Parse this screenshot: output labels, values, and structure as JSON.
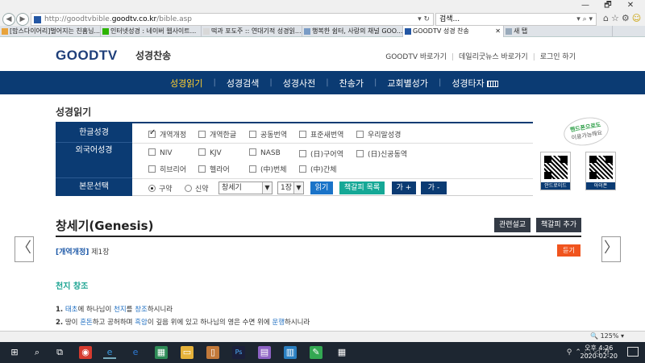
{
  "window": {
    "minimize": "🗗",
    "close": "✕"
  },
  "browser": {
    "url_prefix": "http://goodtvbible.",
    "url_domain": "goodtv.co.kr",
    "url_path": "/bible.asp",
    "url_tools": "▾ ↻",
    "search_value": "검색...",
    "search_tools": "▾ ⌕ ▾",
    "tabs": [
      {
        "label": "[맘스다이어리]벌어지는 친홈님...",
        "color": "#e8a33c"
      },
      {
        "label": "인터넷성경 : 네이버 웹사이트...",
        "color": "#2db400"
      },
      {
        "label": "떡과 포도주 :: 연대기적 성경읽...",
        "color": "#d8d8d8"
      },
      {
        "label": "행복한 쉼터, 사랑의 채널 GOO...",
        "color": "#7a9cc6"
      },
      {
        "label": "GOODTV 성경 찬송",
        "color": "#2457a4"
      },
      {
        "label": "새 탭",
        "color": "#9ab"
      }
    ]
  },
  "site": {
    "logo_good": "GOOD",
    "logo_tv": "TV",
    "logo_sub": "성경찬송",
    "top_links": [
      "GOODTV 바로가기",
      "데일리굿뉴스 바로가기",
      "로그인 하기"
    ],
    "menu": [
      "성경읽기",
      "성경검색",
      "성경사전",
      "찬송가",
      "교회별성가",
      "성경타자"
    ]
  },
  "reader": {
    "section_title": "성경읽기",
    "labels": {
      "korean": "한글성경",
      "foreign": "외국어성경",
      "select": "본문선택"
    },
    "korean_versions": [
      {
        "label": "개역개정",
        "checked": true
      },
      {
        "label": "개역한글",
        "checked": false
      },
      {
        "label": "공동번역",
        "checked": false
      },
      {
        "label": "표준새번역",
        "checked": false
      },
      {
        "label": "우리말성경",
        "checked": false
      }
    ],
    "foreign_row1": [
      "NIV",
      "KJV",
      "NASB",
      "(日)구어역",
      "(日)신공동역"
    ],
    "foreign_row2": [
      "히브리어",
      "헬라어",
      "(中)번체",
      "(中)간체"
    ],
    "testament_old": "구약",
    "testament_new": "신약",
    "book_select": "창세기",
    "chapter_select": "1장",
    "read_button": "읽기",
    "bookmark_list_button": "책갈피 목록",
    "font_plus": "가 +",
    "font_minus": "가 -",
    "stamp_line1": "핸드폰으로도",
    "stamp_line2": "이용가능해요",
    "qr_android": "안드로이드",
    "qr_iphone": "아이폰"
  },
  "content": {
    "book_title": "창세기(Genesis)",
    "related_sermon": "관련설교",
    "add_bookmark": "책갈피 추가",
    "version_tag": "[개역개정]",
    "chapter": "제1장",
    "listen": "듣기",
    "heading": "천지 창조",
    "verses": [
      {
        "num": "1.",
        "parts": [
          [
            "태초",
            true
          ],
          [
            "에 하나님이 ",
            false
          ],
          [
            "천지",
            true
          ],
          [
            "를 ",
            false
          ],
          [
            "창조",
            true
          ],
          [
            "하시니라",
            false
          ]
        ]
      },
      {
        "num": "2.",
        "parts": [
          [
            "땅이 ",
            false
          ],
          [
            "혼돈",
            true
          ],
          [
            "하고 공허하며 ",
            false
          ],
          [
            "흑암",
            true
          ],
          [
            "이 깊음 위에 있고 하나님의 영은 수면 위에 ",
            false
          ],
          [
            "운행",
            true
          ],
          [
            "하시니라",
            false
          ]
        ]
      }
    ],
    "prev_arrow": "〈",
    "next_arrow": "〉"
  },
  "status": {
    "zoom": "125%"
  },
  "taskbar": {
    "clock_time": "오후 4:26",
    "clock_date": "2020-02-20",
    "ime": "가"
  }
}
